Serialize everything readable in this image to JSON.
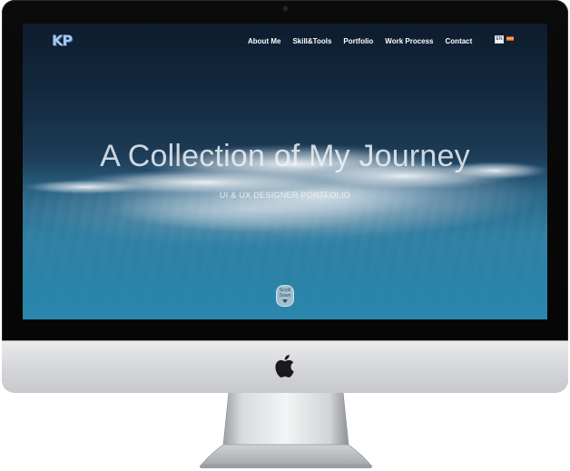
{
  "site": {
    "logo_text": "KP"
  },
  "nav": {
    "items": [
      {
        "label": "About Me"
      },
      {
        "label": "Skill&Tools"
      },
      {
        "label": "Portfolio"
      },
      {
        "label": "Work Process"
      },
      {
        "label": "Contact"
      }
    ],
    "languages": [
      {
        "code": "EN",
        "icon": "flag-en-icon"
      },
      {
        "code": "",
        "icon": "flag-alt-icon"
      }
    ]
  },
  "hero": {
    "title": "A Collection of My Journey",
    "subtitle": "UI & UX DESIGNER PORTFOLIO",
    "scroll_label_1": "Scroll",
    "scroll_label_2": "Down"
  },
  "colors": {
    "sky_dark": "#0d1c2d",
    "sky_light": "#2b86ad",
    "logo": "#a8c8f0"
  }
}
